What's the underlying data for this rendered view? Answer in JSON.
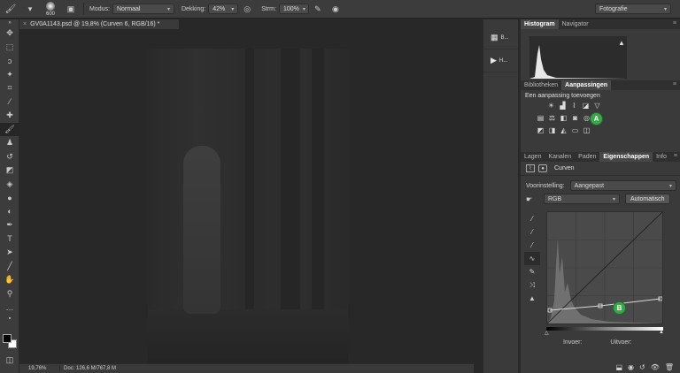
{
  "options_bar": {
    "brush_size": "600",
    "modus_label": "Modus:",
    "modus_value": "Normaal",
    "dekking_label": "Dekking:",
    "dekking_value": "42%",
    "strm_label": "Strm:",
    "strm_value": "100%",
    "workspace_value": "Fotografie"
  },
  "document": {
    "tab_title": "GV0A1143.psd @ 19,8% (Curven 6, RGB/16) *",
    "tab_close": "×",
    "zoom": "19,76%",
    "doc_info": "Doc: 126,6 M/767,8 M"
  },
  "dock": {
    "items": [
      {
        "icon": "layer-comp-icon",
        "label": "B..."
      },
      {
        "icon": "play-icon",
        "label": "H..."
      }
    ]
  },
  "panels": {
    "top_tabs": [
      "Histogram",
      "Navigator"
    ],
    "mid_tabs": [
      "Bibliotheken",
      "Aanpassingen"
    ],
    "adjustments_title": "Een aanpassing toevoegen",
    "layer_tabs": [
      "Lagen",
      "Kanalen",
      "Paden",
      "Eigenschappen",
      "Info"
    ],
    "marker_a": "A",
    "marker_b": "B"
  },
  "properties": {
    "title": "Curven",
    "preset_label": "Voorinstelling:",
    "preset_value": "Aangepast",
    "channel_value": "RGB",
    "auto_button": "Automatisch",
    "input_label": "Invoer:",
    "output_label": "Uitvoer:"
  },
  "colors": {
    "accent_marker": "#3aa64a",
    "panel_bg": "#3a3a3a",
    "canvas_bg": "#282828"
  }
}
